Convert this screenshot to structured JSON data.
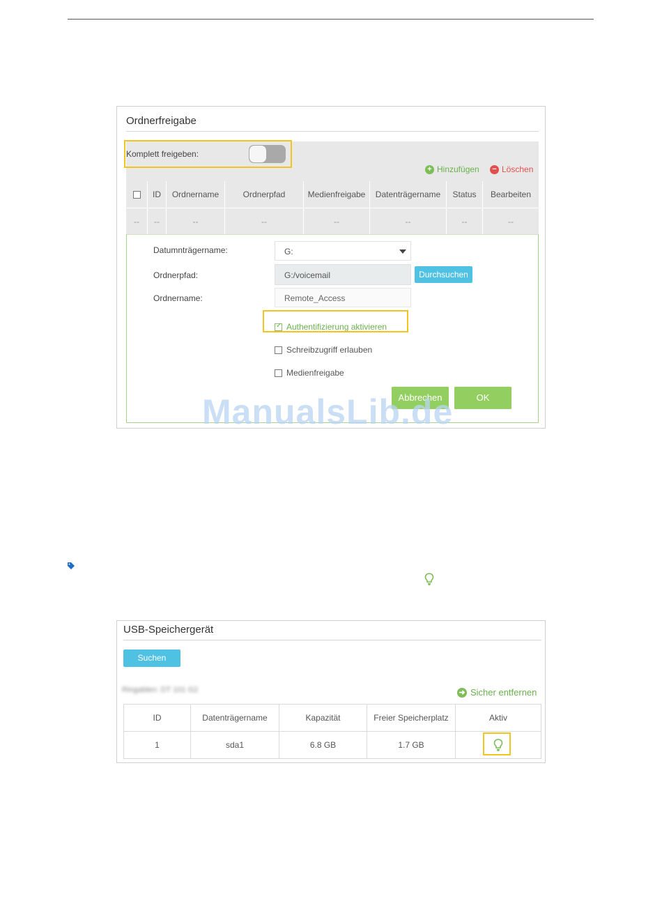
{
  "panel1": {
    "title": "Ordnerfreigabe",
    "toggle_label": "Komplett freigeben:",
    "toggle_on": false,
    "add_label": "Hinzufügen",
    "delete_label": "Löschen",
    "table": {
      "columns": [
        "ID",
        "Ordnername",
        "Ordnerpfad",
        "Medienfreigabe",
        "Datenträgername",
        "Status",
        "Bearbeiten"
      ],
      "row": [
        "--",
        "--",
        "--",
        "--",
        "--",
        "--",
        "--",
        "--"
      ]
    },
    "form": {
      "drive_label": "Datumnträgername:",
      "drive_value": "G:",
      "path_label": "Ordnerpfad:",
      "path_value": "G:/voicemail",
      "browse_label": "Durchsuchen",
      "name_label": "Ordnername:",
      "name_value": "Remote_Access",
      "auth_label": "Authentifizierung aktivieren",
      "auth_checked": true,
      "write_label": "Schreibzugriff erlauben",
      "write_checked": false,
      "media_label": "Medienfreigabe",
      "media_checked": false,
      "cancel_label": "Abbrechen",
      "ok_label": "OK"
    }
  },
  "watermark": "ManualsLib.de",
  "panel2": {
    "title": "USB-Speichergerät",
    "search_label": "Suchen",
    "blurred_text": "Ringablen: DT 101 G2",
    "safe_remove_label": "Sicher entfernen",
    "table": {
      "columns": [
        "ID",
        "Datenträgername",
        "Kapazität",
        "Freier Speicherplatz",
        "Aktiv"
      ],
      "rows": [
        {
          "id": "1",
          "name": "sda1",
          "capacity": "6.8 GB",
          "free": "1.7 GB"
        }
      ]
    }
  },
  "colors": {
    "highlight": "#f2c420",
    "green": "#92cf60",
    "blue_button": "#4fc1e3",
    "red": "#e0504d"
  }
}
